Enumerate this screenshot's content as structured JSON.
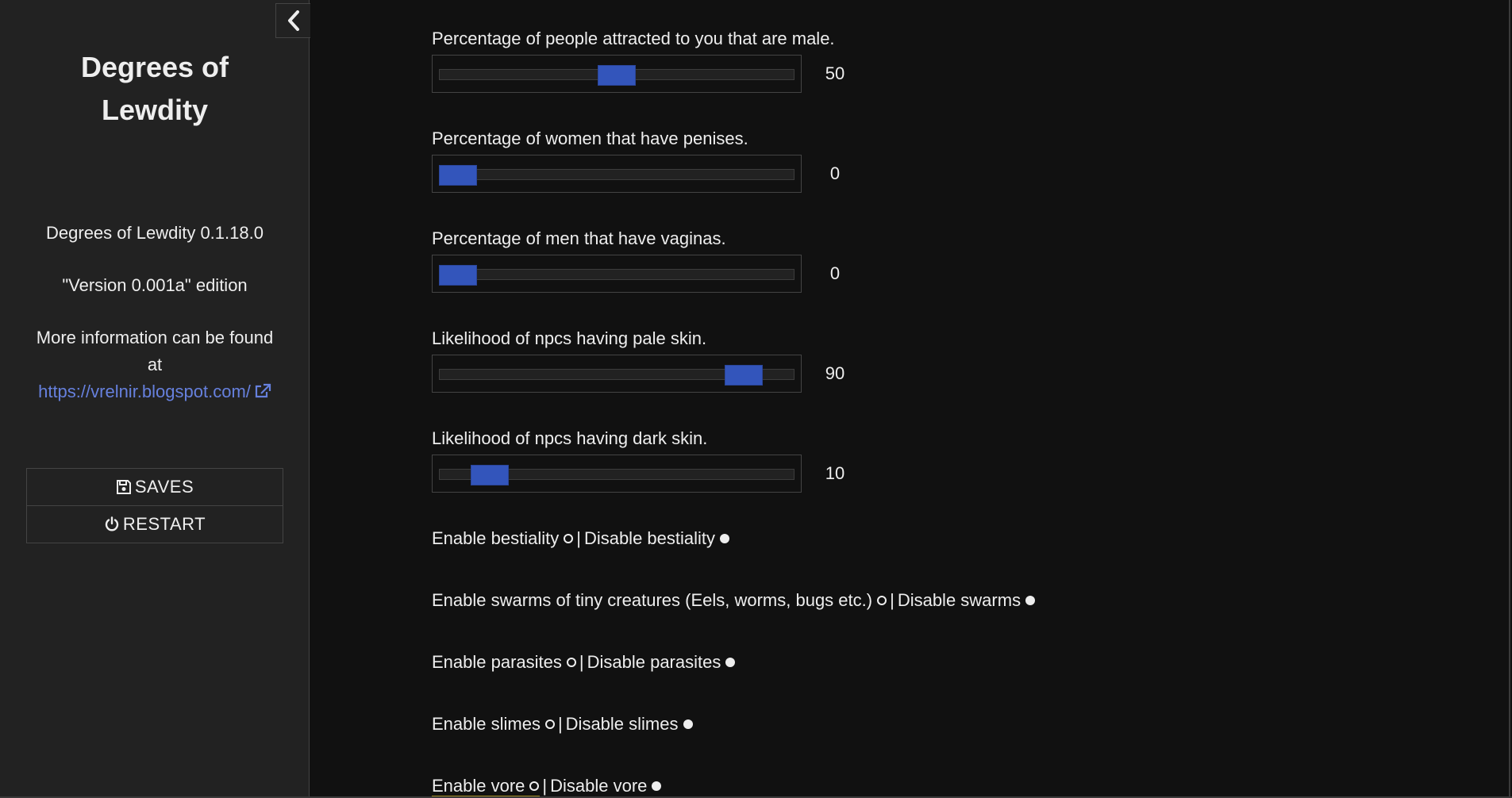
{
  "sidebar": {
    "title_line1": "Degrees of",
    "title_line2": "Lewdity",
    "version": "Degrees of Lewdity 0.1.18.0",
    "edition": "\"Version 0.001a\" edition",
    "info_line1": "More information can be found",
    "info_line2": "at",
    "link_text": "https://vrelnir.blogspot.com/",
    "menu": {
      "saves_label": "SAVES",
      "restart_label": "RESTART"
    },
    "icons": {
      "stow": "chevron-left-icon",
      "external": "external-link-icon",
      "saves": "floppy-disk-icon",
      "restart": "power-icon"
    }
  },
  "sliders": [
    {
      "label": "Percentage of people attracted to you that are male.",
      "value": "50",
      "level": 0.5
    },
    {
      "label": "Percentage of women that have penises.",
      "value": "0",
      "level": 0.0
    },
    {
      "label": "Percentage of men that have vaginas.",
      "value": "0",
      "level": 0.0
    },
    {
      "label": "Likelihood of npcs having pale skin.",
      "value": "90",
      "level": 0.9
    },
    {
      "label": "Likelihood of npcs having dark skin.",
      "value": "10",
      "level": 0.1
    }
  ],
  "toggles": [
    {
      "enable": "Enable bestiality",
      "disable": "Disable bestiality",
      "selected": "disable"
    },
    {
      "enable": "Enable swarms of tiny creatures (Eels, worms, bugs etc.)",
      "disable": "Disable swarms",
      "selected": "disable"
    },
    {
      "enable": "Enable parasites",
      "disable": "Disable parasites",
      "selected": "disable"
    },
    {
      "enable": "Enable slimes",
      "disable": "Disable slimes",
      "selected": "disable"
    },
    {
      "enable": "Enable vore",
      "disable": "Disable vore",
      "selected": "disable"
    }
  ],
  "colors": {
    "accent": "#3355bb",
    "link": "#6680dd",
    "background": "#111111",
    "sidebar": "#222222"
  }
}
